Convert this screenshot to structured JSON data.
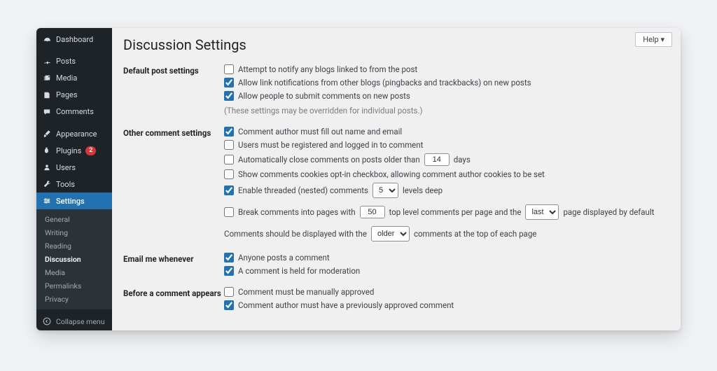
{
  "help": {
    "label": "Help ▾"
  },
  "page": {
    "title": "Discussion Settings"
  },
  "sidebar": {
    "dashboard": "Dashboard",
    "posts": "Posts",
    "media": "Media",
    "pages": "Pages",
    "comments": "Comments",
    "appearance": "Appearance",
    "plugins": "Plugins",
    "plugins_badge": "2",
    "users": "Users",
    "tools": "Tools",
    "settings": "Settings",
    "submenu": {
      "general": "General",
      "writing": "Writing",
      "reading": "Reading",
      "discussion": "Discussion",
      "media": "Media",
      "permalinks": "Permalinks",
      "privacy": "Privacy"
    },
    "collapse": "Collapse menu"
  },
  "sections": {
    "default_post": {
      "heading": "Default post settings",
      "opt_notify": "Attempt to notify any blogs linked to from the post",
      "opt_pingback": "Allow link notifications from other blogs (pingbacks and trackbacks) on new posts",
      "opt_allow_comments": "Allow people to submit comments on new posts",
      "note": "(These settings may be overridden for individual posts.)"
    },
    "other": {
      "heading": "Other comment settings",
      "opt_name_email": "Comment author must fill out name and email",
      "opt_registered": "Users must be registered and logged in to comment",
      "opt_autoclose_pre": "Automatically close comments on posts older than",
      "opt_autoclose_days": "14",
      "opt_autoclose_post": "days",
      "opt_cookies": "Show comments cookies opt-in checkbox, allowing comment author cookies to be set",
      "opt_threaded_pre": "Enable threaded (nested) comments",
      "opt_threaded_levels": "5",
      "opt_threaded_post": "levels deep",
      "opt_paginate_pre": "Break comments into pages with",
      "opt_paginate_num": "50",
      "opt_paginate_mid": "top level comments per page and the",
      "opt_paginate_page": "last",
      "opt_paginate_post": "page displayed by default",
      "opt_order_pre": "Comments should be displayed with the",
      "opt_order_sel": "older",
      "opt_order_post": "comments at the top of each page"
    },
    "email": {
      "heading": "Email me whenever",
      "opt_anyone": "Anyone posts a comment",
      "opt_held": "A comment is held for moderation"
    },
    "before": {
      "heading": "Before a comment appears",
      "opt_manual": "Comment must be manually approved",
      "opt_prev_approved": "Comment author must have a previously approved comment"
    }
  }
}
